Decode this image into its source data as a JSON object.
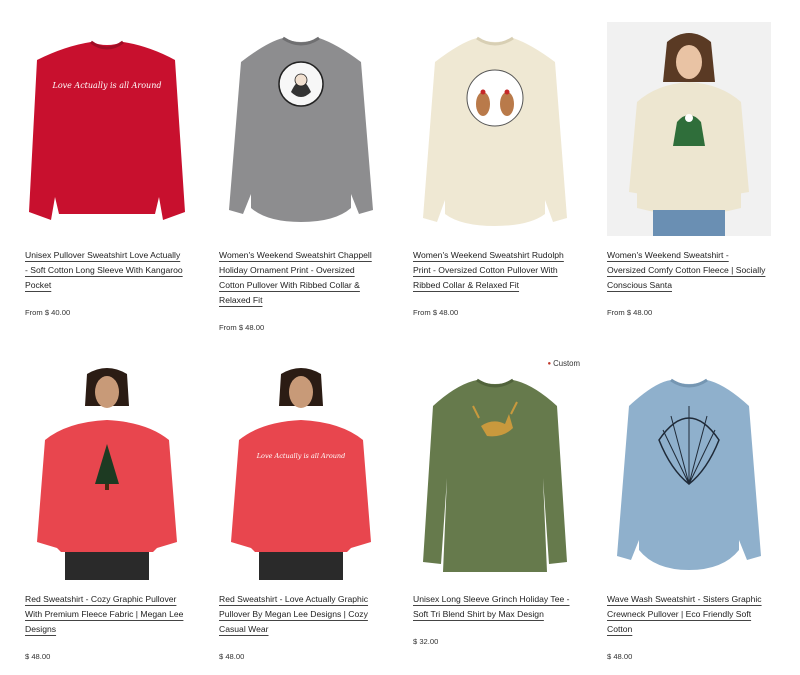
{
  "products": [
    {
      "title": "Unisex Pullover Sweatshirt Love Actually - Soft Cotton Long Sleeve With Kangaroo Pocket",
      "price": "From $ 40.00",
      "color": "#c8102e",
      "print_text": "Love Actually is all Around"
    },
    {
      "title": "Women's Weekend Sweatshirt Chappell Holiday Ornament Print - Oversized Cotton Pullover With Ribbed Collar & Relaxed Fit",
      "price": "From $ 48.00",
      "color": "#8d8d8f"
    },
    {
      "title": "Women's Weekend Sweatshirt Rudolph Print - Oversized Cotton Pullover With Ribbed Collar & Relaxed Fit",
      "price": "From $ 48.00",
      "color": "#efe8d3"
    },
    {
      "title": "Women's Weekend Sweatshirt - Oversized Comfy Cotton Fleece | Socially Conscious Santa",
      "price": "From $ 48.00",
      "color": "#ede6d0"
    },
    {
      "title": "Red Sweatshirt - Cozy Graphic Pullover With Premium Fleece Fabric | Megan Lee Designs",
      "price": "$ 48.00",
      "color": "#e8464e"
    },
    {
      "title": "Red Sweatshirt - Love Actually Graphic Pullover By Megan Lee Designs | Cozy Casual Wear",
      "price": "$ 48.00",
      "color": "#e8464e",
      "print_text": "Love Actually is all Around"
    },
    {
      "title": "Unisex Long Sleeve Grinch Holiday Tee - Soft Tri Blend Shirt by Max Design",
      "price": "$ 32.00",
      "color": "#667a4c",
      "badge": "Custom"
    },
    {
      "title": "Wave Wash Sweatshirt - Sisters Graphic Crewneck Pullover | Eco Friendly Soft Cotton",
      "price": "$ 48.00",
      "color": "#8fb0cc"
    }
  ]
}
